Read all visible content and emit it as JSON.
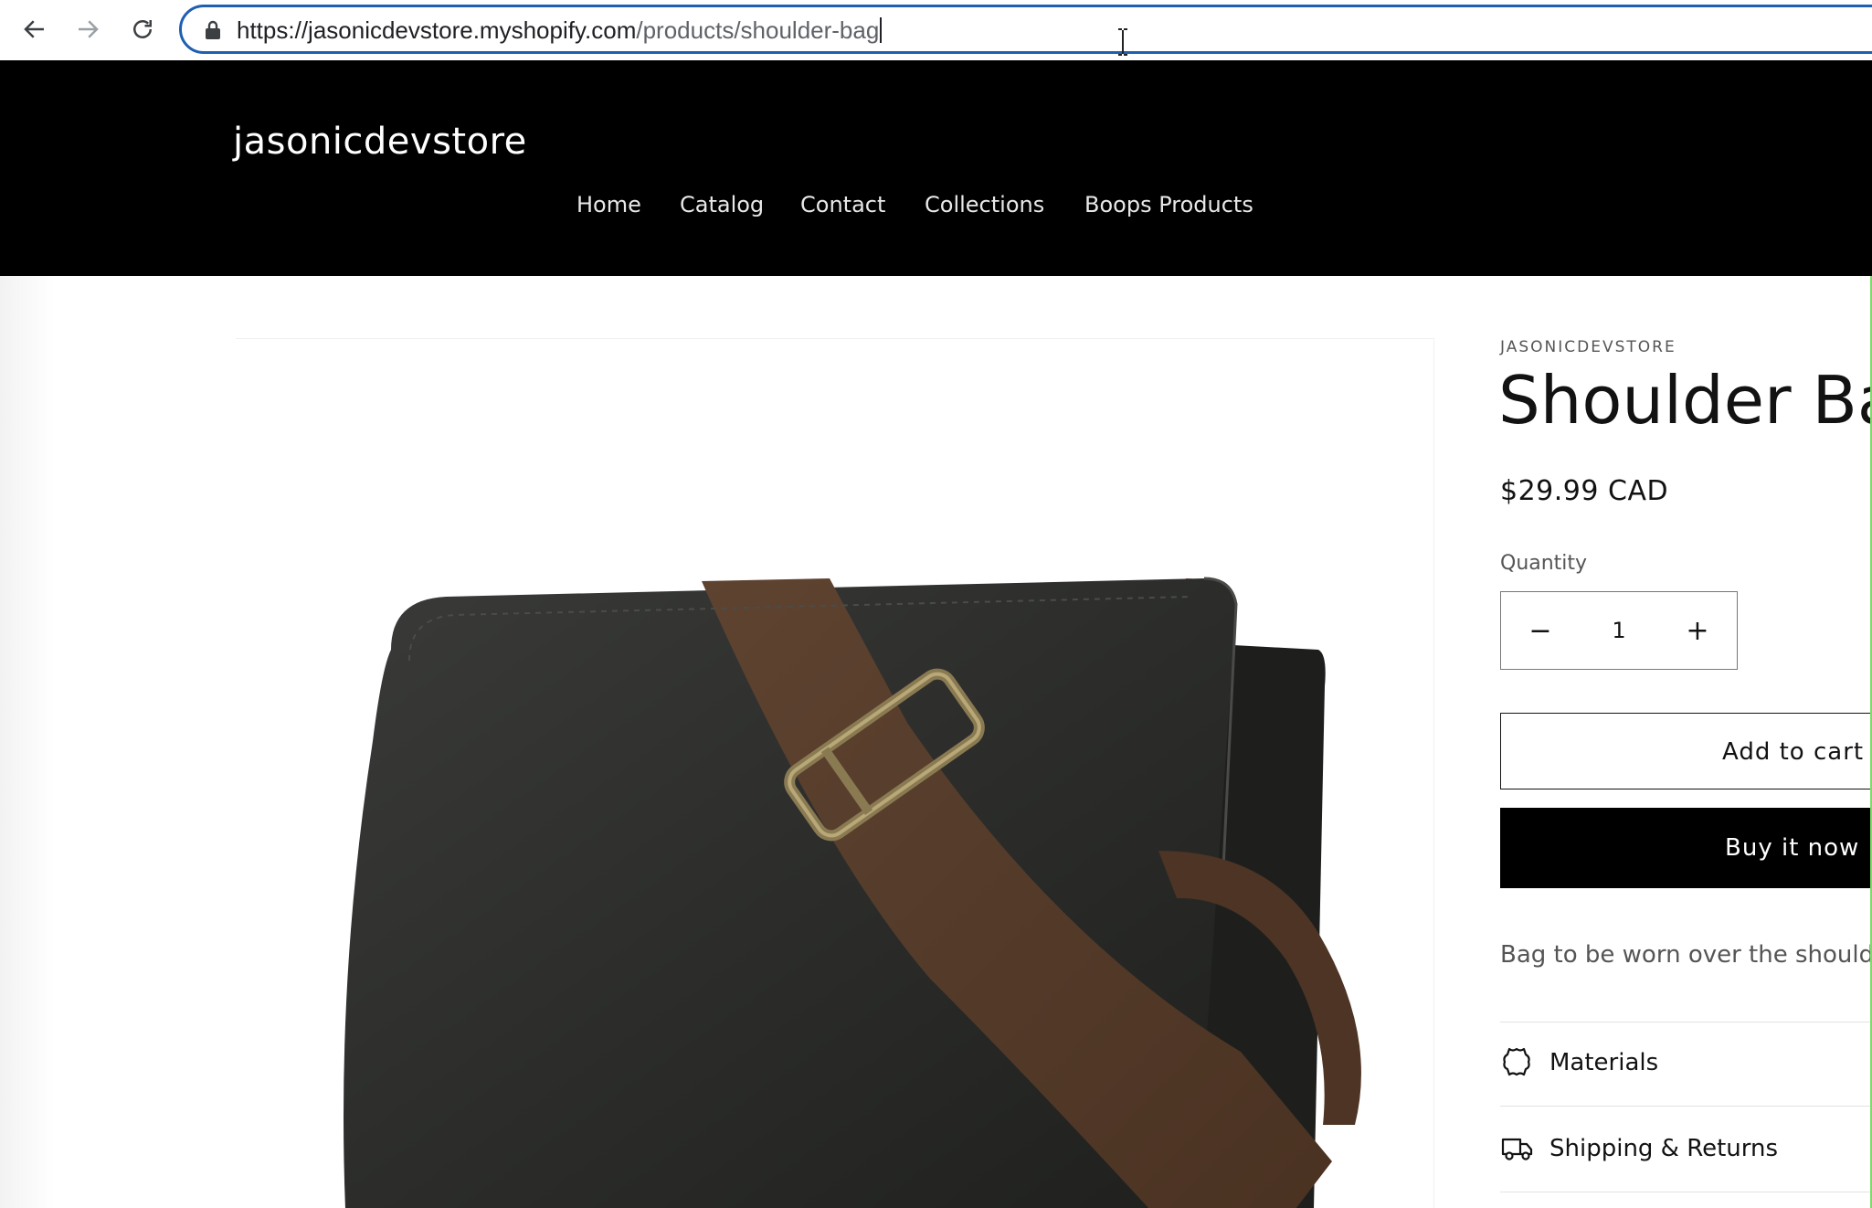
{
  "browser": {
    "url_host": "https://jasonicdevstore.myshopify.com",
    "url_path": "/products/shoulder-bag"
  },
  "store": {
    "brand": "jasonicdevstore",
    "menu": [
      "Home",
      "Catalog",
      "Contact",
      "Collections",
      "Boops Products"
    ]
  },
  "product": {
    "vendor": "JASONICDEVSTORE",
    "title": "Shoulder Bag",
    "price": "$29.99 CAD",
    "quantity_label": "Quantity",
    "quantity": "1",
    "decrease_symbol": "−",
    "increase_symbol": "+",
    "add_to_cart": "Add to cart",
    "buy_now": "Buy it now",
    "description": "Bag to be worn over the should",
    "accordion": [
      {
        "label": "Materials",
        "icon": "leather-icon"
      },
      {
        "label": "Shipping & Returns",
        "icon": "truck-icon"
      }
    ]
  },
  "colors": {
    "header_bg": "#000000",
    "url_border": "#1f5fb0",
    "text": "#121212",
    "muted": "#555555"
  }
}
